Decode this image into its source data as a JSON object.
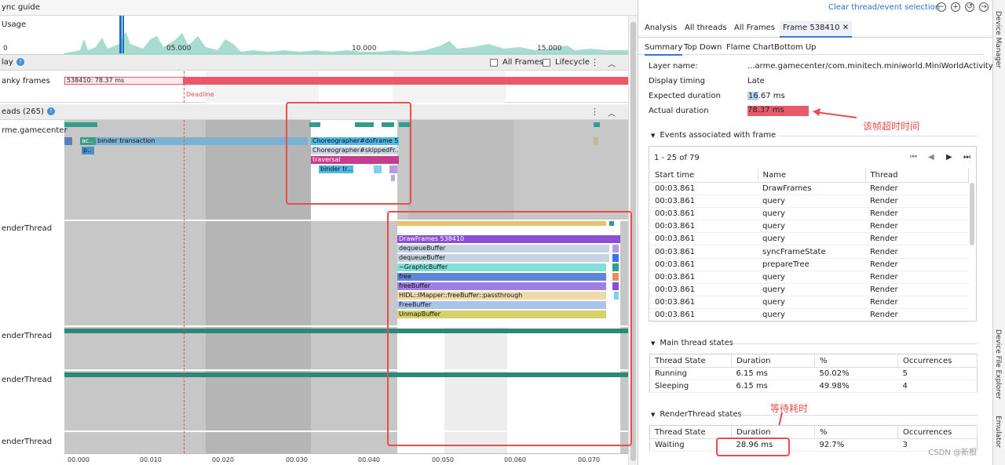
{
  "topbar": {
    "title": "ync guide"
  },
  "usage": {
    "label": "Usage",
    "ticks": [
      "05.000",
      "10.000",
      "15.000"
    ],
    "zero_tick": "0"
  },
  "display": {
    "label": "lay",
    "all_frames": "All Frames",
    "lifecycle": "Lifecycle",
    "jank_label": "anky frames",
    "frame_label": "538410: 78.37 ms",
    "deadline": "Deadline"
  },
  "threads": {
    "label": "eads (265)",
    "rows": [
      {
        "name": "rme.gamecenter"
      },
      {
        "name": "enderThread"
      },
      {
        "name": "enderThread"
      },
      {
        "name": "enderThread"
      },
      {
        "name": "enderThread"
      }
    ],
    "main_slices": {
      "binder": "binder transaction",
      "ac": "ac..",
      "p": "p..",
      "choreo": "Choreographer#doFrame 5...",
      "skipped": "Choreographer#skippedFr...",
      "traversal": "traversal",
      "bindertr": "binder tr..."
    },
    "render_slices": [
      {
        "label": "DrawFrames 538410",
        "color": "#8a4fd6"
      },
      {
        "label": "dequeueBuffer",
        "color": "#c5d3e3"
      },
      {
        "label": "dequeueBuffer",
        "color": "#c5d3e3"
      },
      {
        "label": "~GraphicBuffer",
        "color": "#7fe0d8"
      },
      {
        "label": "free",
        "color": "#5d86d8"
      },
      {
        "label": "freeBuffer",
        "color": "#9f7fe0"
      },
      {
        "label": "HIDL::IMapper::freeBuffer::passthrough",
        "color": "#eed9a8"
      },
      {
        "label": "FreeBuffer",
        "color": "#a9c4e8"
      },
      {
        "label": "UnmapBuffer",
        "color": "#d6d26a"
      }
    ]
  },
  "axis_ticks": [
    "00.000",
    "00.010",
    "00.020",
    "00.030",
    "00.040",
    "00.050",
    "00.060",
    "00.070"
  ],
  "right": {
    "clear": "Clear thread/event selection",
    "tabs": [
      "Analysis",
      "All threads",
      "All Frames",
      "Frame 538410"
    ],
    "subtabs": [
      "Summary",
      "Top Down",
      "Flame Chart",
      "Bottom Up"
    ],
    "summary": {
      "layer_name_label": "Layer name:",
      "layer_name": "...arme.gamecenter/com.minitech.miniworld.MiniWorldActivity#0",
      "display_timing_label": "Display timing",
      "display_timing": "Late",
      "expected_label": "Expected duration",
      "expected": "16.67 ms",
      "actual_label": "Actual duration",
      "actual": "78.37 ms"
    },
    "annotation_frame": "该帧超时时间",
    "annotation_wait": "等待耗时",
    "events": {
      "title": "Events associated with frame",
      "pager": "1 - 25 of 79",
      "columns": [
        "Start time",
        "Name",
        "Thread"
      ],
      "rows": [
        [
          "00:03.861",
          "DrawFrames",
          "Render"
        ],
        [
          "00:03.861",
          "query",
          "Render"
        ],
        [
          "00:03.861",
          "query",
          "Render"
        ],
        [
          "00:03.861",
          "query",
          "Render"
        ],
        [
          "00:03.861",
          "query",
          "Render"
        ],
        [
          "00:03.861",
          "syncFrameState",
          "Render"
        ],
        [
          "00:03.861",
          "prepareTree",
          "Render"
        ],
        [
          "00:03.861",
          "query",
          "Render"
        ],
        [
          "00:03.861",
          "query",
          "Render"
        ],
        [
          "00:03.861",
          "query",
          "Render"
        ],
        [
          "00:03.861",
          "query",
          "Render"
        ]
      ]
    },
    "main_states": {
      "title": "Main thread states",
      "columns": [
        "Thread State",
        "Duration",
        "%",
        "Occurrences"
      ],
      "rows": [
        [
          "Running",
          "6.15 ms",
          "50.02%",
          "5"
        ],
        [
          "Sleeping",
          "6.15 ms",
          "49.98%",
          "4"
        ]
      ]
    },
    "render_states": {
      "title": "RenderThread states",
      "columns": [
        "Thread State",
        "Duration",
        "%",
        "Occurrences"
      ],
      "rows": [
        [
          "Waiting",
          "28.96 ms",
          "92.7%",
          "3"
        ]
      ]
    },
    "watermark": "CSDN @新根"
  },
  "sidebar": {
    "items": [
      "Device Manager",
      "Device File Explorer",
      "Emulator"
    ]
  }
}
